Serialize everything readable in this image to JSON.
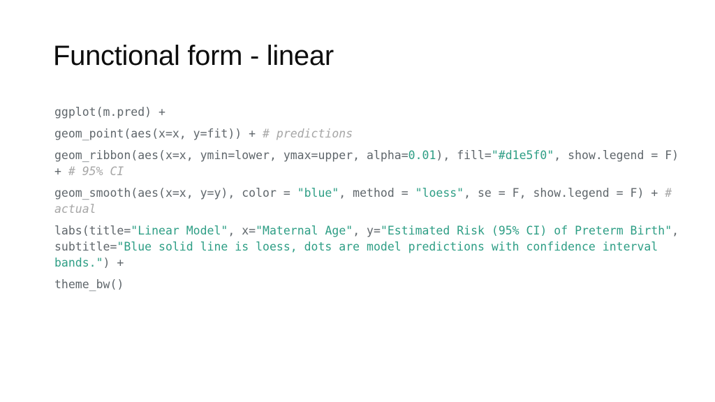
{
  "slide": {
    "title": "Functional form - linear",
    "background_color": "#ffffff",
    "title_color": "#0d0d0d"
  },
  "syntax_colors": {
    "plain": "#5f666b",
    "string": "#2e9e85",
    "number": "#2e9e85",
    "argument": "#3b7fc4",
    "comment": "#a6a6a6"
  },
  "code": {
    "language": "R",
    "full_text": "ggplot(m.pred) +\ngeom_point(aes(x=x, y=fit)) + # predictions\ngeom_ribbon(aes(x=x, ymin=lower, ymax=upper, alpha=0.01), fill=\"#d1e5f0\", show.legend = F) + # 95% CI\ngeom_smooth(aes(x=x, y=y), color = \"blue\", method = \"loess\", se = F, show.legend = F) + # actual\nlabs(title=\"Linear Model\", x=\"Maternal Age\", y=\"Estimated Risk (95% CI) of Preterm Birth\", subtitle=\"Blue solid line is loess, dots are model predictions with confidence interval bands.\") +\ntheme_bw()",
    "paragraphs": [
      {
        "id": "line-ggplot",
        "tokens": [
          {
            "text": "ggplot(m.pred) +",
            "type": "plain"
          }
        ]
      },
      {
        "id": "line-geom-point",
        "tokens": [
          {
            "text": "geom_point(aes(x=x, y=fit)) + ",
            "type": "plain"
          },
          {
            "text": "# predictions",
            "type": "comment"
          }
        ]
      },
      {
        "id": "line-geom-ribbon",
        "tokens": [
          {
            "text": "geom_ribbon(aes(x=x, ymin=lower, ymax=upper, alpha=",
            "type": "plain"
          },
          {
            "text": "0.01",
            "type": "number"
          },
          {
            "text": "), fill=",
            "type": "plain"
          },
          {
            "text": "\"#d1e5f0\"",
            "type": "string"
          },
          {
            "text": ", show.legend = F) + ",
            "type": "plain"
          },
          {
            "text": "# 95% CI",
            "type": "comment"
          }
        ]
      },
      {
        "id": "line-geom-smooth",
        "tokens": [
          {
            "text": "geom_smooth(aes(x=x, y=y), color = ",
            "type": "plain"
          },
          {
            "text": "\"blue\"",
            "type": "string"
          },
          {
            "text": ", method = ",
            "type": "plain"
          },
          {
            "text": "\"loess\"",
            "type": "string"
          },
          {
            "text": ", se = F, show.legend = F) + ",
            "type": "plain"
          },
          {
            "text": "# actual",
            "type": "comment"
          }
        ]
      },
      {
        "id": "line-labs",
        "tokens": [
          {
            "text": "labs(",
            "type": "plain"
          },
          {
            "text": "title",
            "type": "argument"
          },
          {
            "text": "=",
            "type": "plain"
          },
          {
            "text": "\"Linear Model\"",
            "type": "string"
          },
          {
            "text": ", x=",
            "type": "plain"
          },
          {
            "text": "\"Maternal Age\"",
            "type": "string"
          },
          {
            "text": ", y=",
            "type": "plain"
          },
          {
            "text": "\"Estimated Risk (95% CI) of Preterm Birth\"",
            "type": "string"
          },
          {
            "text": ", subtitle=",
            "type": "plain"
          },
          {
            "text": "\"Blue solid line is loess, dots are model predictions with confidence interval bands.\"",
            "type": "string"
          },
          {
            "text": ") +",
            "type": "plain"
          }
        ]
      },
      {
        "id": "line-theme",
        "tokens": [
          {
            "text": "theme_bw()",
            "type": "plain"
          }
        ]
      }
    ]
  }
}
